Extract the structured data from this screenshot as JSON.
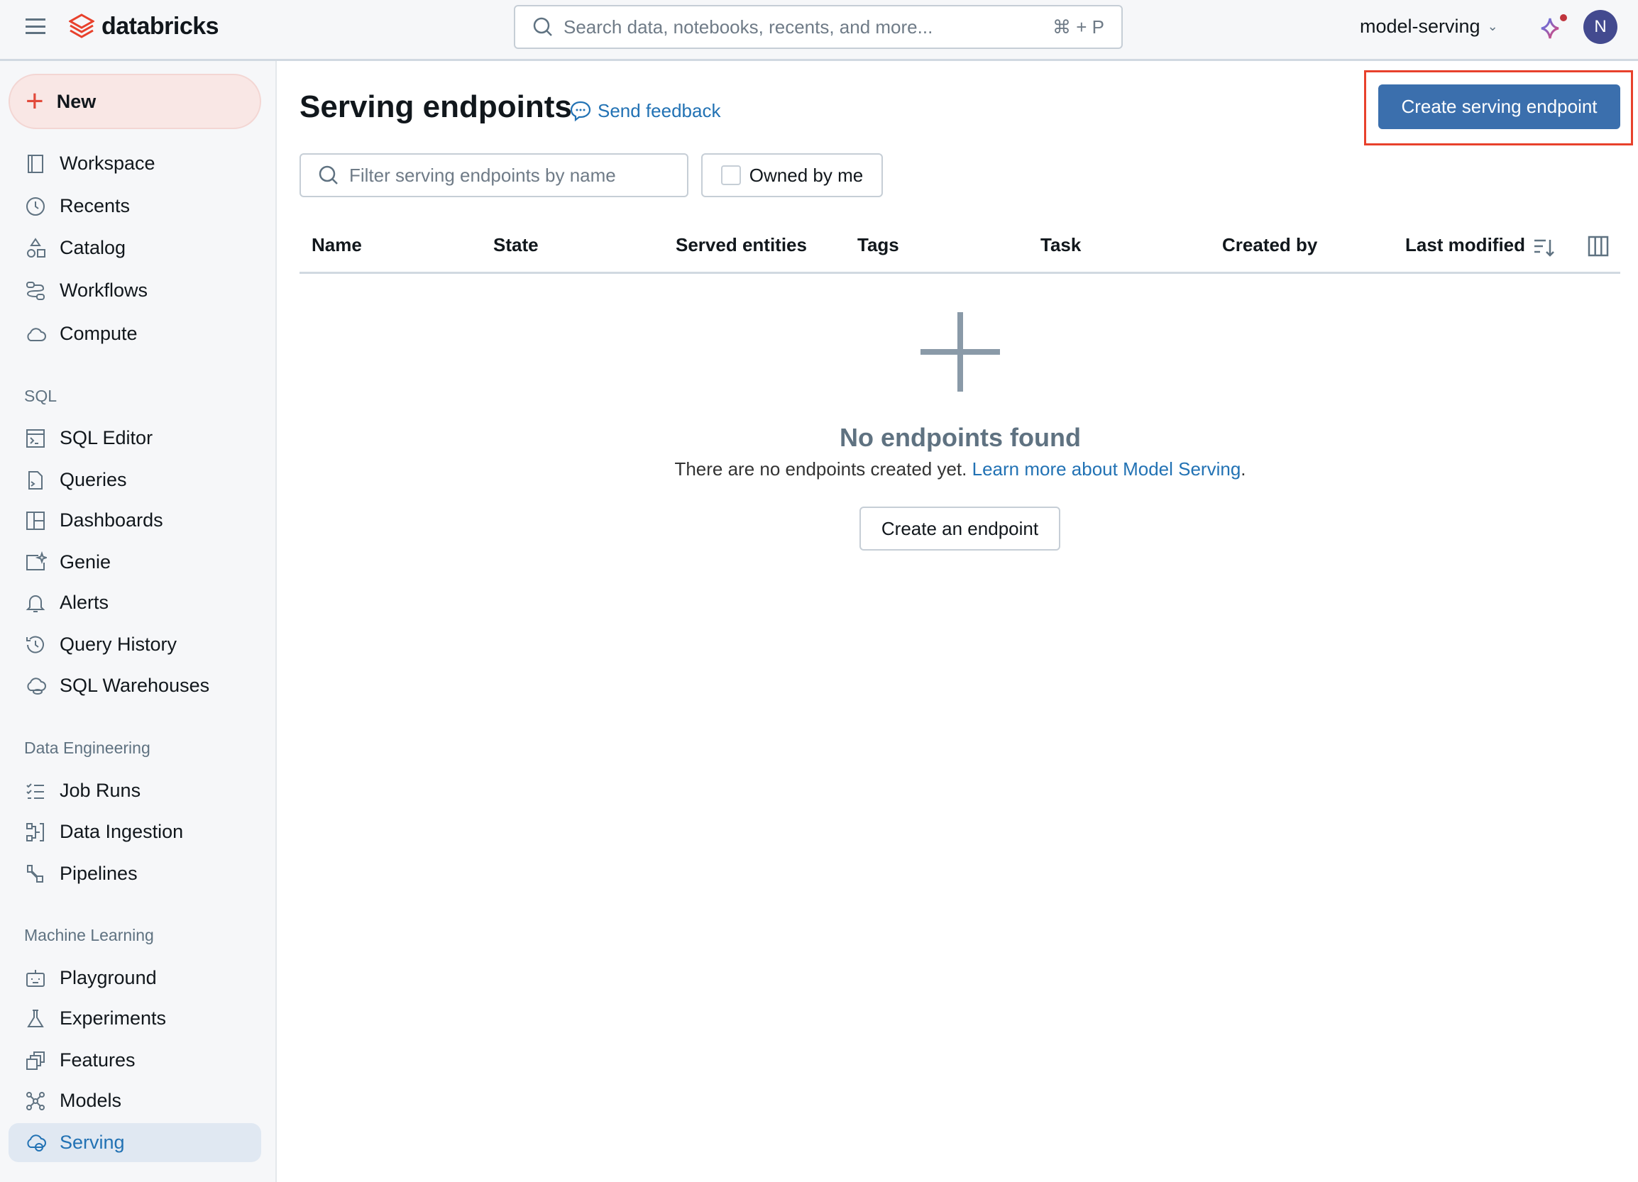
{
  "topbar": {
    "logo_text": "databricks",
    "search_placeholder": "Search data, notebooks, recents, and more...",
    "search_shortcut": "⌘ + P",
    "workspace": "model-serving",
    "avatar_initial": "N"
  },
  "sidebar": {
    "new_label": "New",
    "main_items": [
      {
        "label": "Workspace"
      },
      {
        "label": "Recents"
      },
      {
        "label": "Catalog"
      },
      {
        "label": "Workflows"
      },
      {
        "label": "Compute"
      }
    ],
    "sections": [
      {
        "title": "SQL",
        "items": [
          {
            "label": "SQL Editor"
          },
          {
            "label": "Queries"
          },
          {
            "label": "Dashboards"
          },
          {
            "label": "Genie"
          },
          {
            "label": "Alerts"
          },
          {
            "label": "Query History"
          },
          {
            "label": "SQL Warehouses"
          }
        ]
      },
      {
        "title": "Data Engineering",
        "items": [
          {
            "label": "Job Runs"
          },
          {
            "label": "Data Ingestion"
          },
          {
            "label": "Pipelines"
          }
        ]
      },
      {
        "title": "Machine Learning",
        "items": [
          {
            "label": "Playground"
          },
          {
            "label": "Experiments"
          },
          {
            "label": "Features"
          },
          {
            "label": "Models"
          },
          {
            "label": "Serving"
          }
        ]
      }
    ],
    "active_item": "Serving"
  },
  "main": {
    "title": "Serving endpoints",
    "feedback_link": "Send feedback",
    "create_button": "Create serving endpoint",
    "filter_placeholder": "Filter serving endpoints by name",
    "owned_by_me": "Owned by me",
    "owned_by_me_checked": false,
    "columns": [
      "Name",
      "State",
      "Served entities",
      "Tags",
      "Task",
      "Created by",
      "Last modified"
    ],
    "empty_title": "No endpoints found",
    "empty_text": "There are no endpoints created yet.",
    "empty_link": "Learn more about Model Serving",
    "empty_period": ".",
    "empty_button": "Create an endpoint"
  },
  "colors": {
    "primary": "#3b6fad",
    "highlight": "#e8412c",
    "accent": "#2272b4"
  }
}
